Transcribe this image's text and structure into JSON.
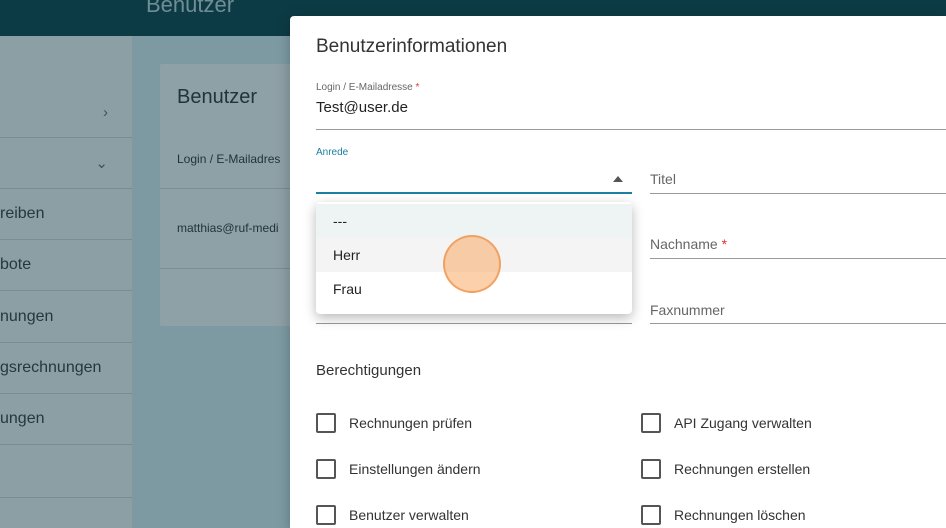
{
  "app": {
    "title": "Benutzer"
  },
  "sidebar": {
    "items": [
      {
        "label": "",
        "chevron": "›"
      },
      {
        "label": "",
        "chevron": "⌄"
      },
      {
        "label": "reiben"
      },
      {
        "label": "bote"
      },
      {
        "label": "nungen"
      },
      {
        "label": "gsrechnungen"
      },
      {
        "label": "ungen"
      },
      {
        "label": ""
      }
    ]
  },
  "background_card": {
    "title": "Benutzer",
    "column_header": "Login / E-Mailadres",
    "row_value": "matthias@ruf-medi"
  },
  "dialog": {
    "title": "Benutzerinformationen",
    "login": {
      "label": "Login / E-Mailadresse",
      "required_mark": "*",
      "value": "Test@user.de"
    },
    "anrede": {
      "label": "Anrede",
      "value": ""
    },
    "titel": {
      "placeholder": "Titel"
    },
    "nachname": {
      "placeholder": "Nachname",
      "required_mark": "*"
    },
    "faxnummer": {
      "placeholder": "Faxnummer"
    },
    "permissions_title": "Berechtigungen",
    "permissions": {
      "rechnungen_pruefen": "Rechnungen prüfen",
      "api_zugang": "API Zugang verwalten",
      "einstellungen": "Einstellungen ändern",
      "rechnungen_erstellen": "Rechnungen erstellen",
      "benutzer_verwalten": "Benutzer verwalten",
      "rechnungen_loeschen": "Rechnungen löschen"
    }
  },
  "dropdown": {
    "options": [
      "---",
      "Herr",
      "Frau"
    ]
  }
}
